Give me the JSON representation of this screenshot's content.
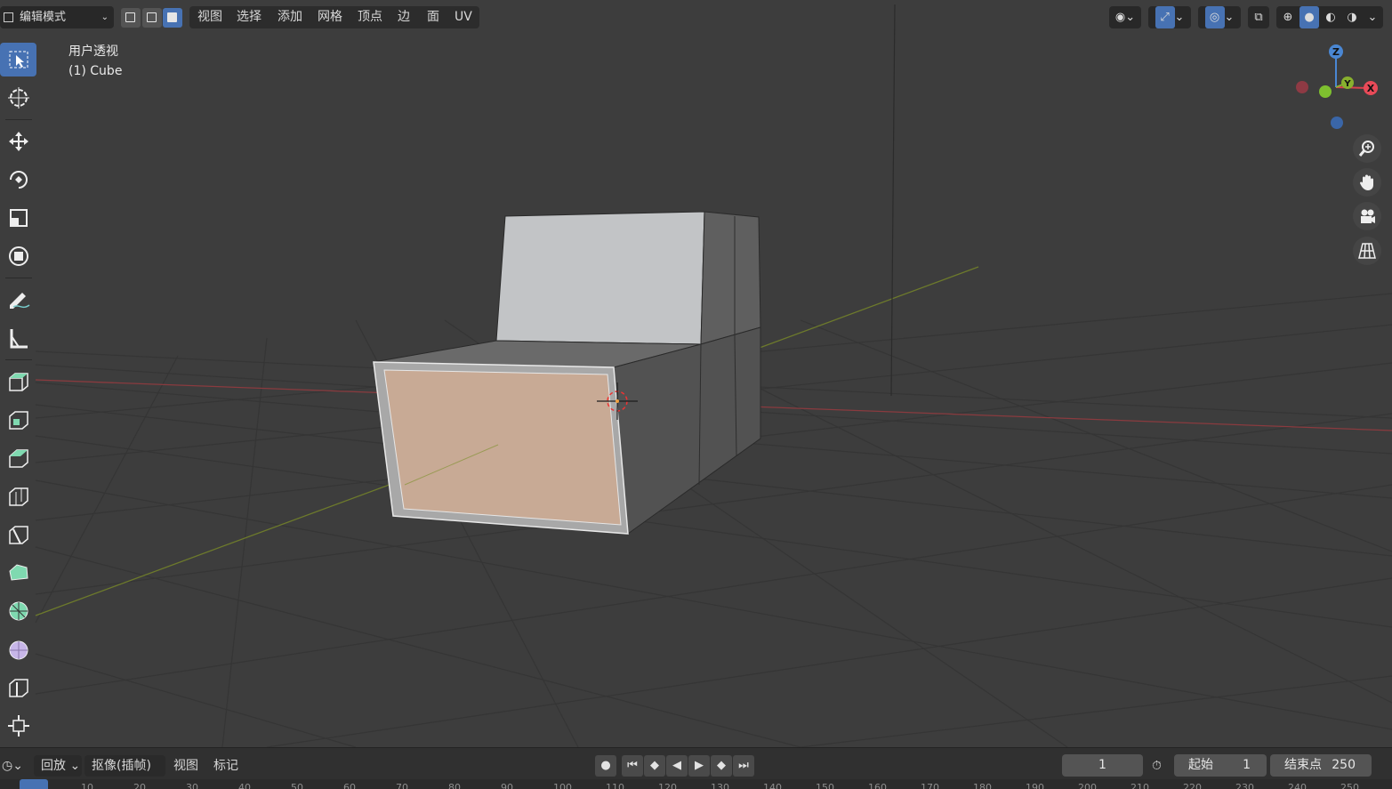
{
  "header": {
    "mode": "编辑模式",
    "menus": [
      "视图",
      "选择",
      "添加",
      "网格",
      "顶点",
      "边",
      "面",
      "UV"
    ]
  },
  "viewport": {
    "view_name": "用户透视",
    "object_name": "(1) Cube",
    "axes": {
      "z": "Z",
      "y": "Y",
      "x": "X"
    }
  },
  "timeline": {
    "playback": "回放",
    "keying": "抠像(插帧)",
    "view": "视图",
    "marker": "标记",
    "current_frame": "1",
    "start_label": "起始",
    "start_value": "1",
    "end_label": "结束点",
    "end_value": "250",
    "ruler": [
      "1",
      "10",
      "20",
      "30",
      "40",
      "50",
      "60",
      "70",
      "80",
      "90",
      "100",
      "110",
      "120",
      "130",
      "140",
      "150",
      "160",
      "170",
      "180",
      "190",
      "200",
      "210",
      "220",
      "230",
      "240",
      "250"
    ]
  },
  "colors": {
    "accent": "#4772b3",
    "selected_face": "#c8aa95",
    "x_axis": "#d9414e",
    "y_axis": "#8bb534",
    "z_axis": "#4a87d3"
  }
}
